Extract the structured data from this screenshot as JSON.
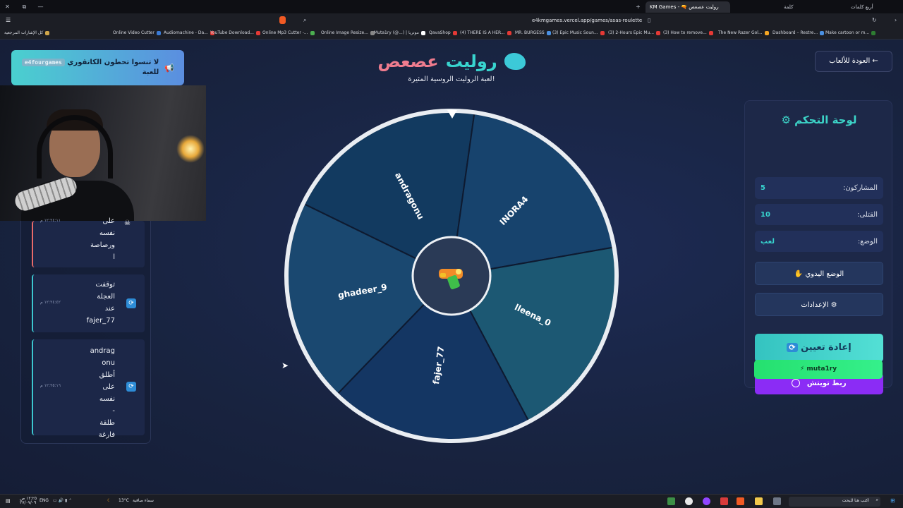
{
  "browser": {
    "tabs": [
      {
        "label": "كلمة",
        "active": false
      },
      {
        "label": "أربع كلمات",
        "active": false
      },
      {
        "label": "KM Games - 🔫 روليت عصعص",
        "active": true
      }
    ],
    "url": "e4kmgames.vercel.app/games/asas-roulette",
    "bookmarks": [
      {
        "label": "كل الإشارات المرجعية",
        "color": "#d0a64a"
      },
      {
        "label": "Online Video Cutter",
        "color": "#3a7bd5"
      },
      {
        "label": "Audiomachine - Da...",
        "color": "#e53935"
      },
      {
        "label": "YouTube Download...",
        "color": "#e53935"
      },
      {
        "label": "Online Mp3 Cutter -...",
        "color": "#4caf50"
      },
      {
        "label": "Online Image Resize...",
        "color": "#888888"
      },
      {
        "label": "Muta1ry (@...) | موتريا",
        "color": "#ffffff"
      },
      {
        "label": "QavaShop",
        "color": "#e53935"
      },
      {
        "label": "(4) THERE IS A HER...",
        "color": "#e53935"
      },
      {
        "label": "MR. BURGESS",
        "color": "#4a90e2"
      },
      {
        "label": "(3) Epic Music Soun...",
        "color": "#e53935"
      },
      {
        "label": "(3) 2-Hours Epic Mu...",
        "color": "#e53935"
      },
      {
        "label": "(3) How to remove...",
        "color": "#e53935"
      },
      {
        "label": "The New Razer Gol...",
        "color": "#f5a623"
      },
      {
        "label": "Dashboard – Restre...",
        "color": "#4a90e2"
      },
      {
        "label": "Make cartoon or m...",
        "color": "#2e7d32"
      }
    ]
  },
  "notice": {
    "text": "لا تنسوا تحطون الكاتقوري",
    "tag": "e4fourgames",
    "text2": "للعبة"
  },
  "header": {
    "title_main": "روليت",
    "title_accent": "عصعص",
    "subtitle": "لعبة الروليت الروسية المثيرة!",
    "back_label": "← العودة للألعاب"
  },
  "wheel": {
    "segments": [
      {
        "name": "andragonu",
        "color": "#123a60"
      },
      {
        "name": "INORA4",
        "color": "#17436d"
      },
      {
        "name": "lleena_0",
        "color": "#1c5873"
      },
      {
        "name": "fajer_77",
        "color": "#143663"
      },
      {
        "name": "ghadeer_9",
        "color": "#1a4870"
      }
    ],
    "center_icon": "water-gun-icon"
  },
  "log": {
    "items": [
      {
        "lines": [
          "على",
          "نفسه",
          "ورصاصة",
          "ا"
        ],
        "time": "١٢:٢٤:١١ م",
        "style": "red"
      },
      {
        "lines": [
          "توقفت",
          "العجلة",
          "عند",
          "fajer_77"
        ],
        "time": "١٢:٢٤:٤٢ م",
        "style": "cyan"
      },
      {
        "lines": [
          "andrag",
          "onu",
          "أطلق",
          "على",
          "نفسه",
          "-",
          "طلقة",
          "فارغة"
        ],
        "time": "١٢:٢٥:١٦ م",
        "style": "cyan"
      }
    ]
  },
  "panel": {
    "title": "لوحة التحكم",
    "stats": [
      {
        "label": "المشاركون:",
        "value": "5"
      },
      {
        "label": "القتلى:",
        "value": "10"
      },
      {
        "label": "الوضع:",
        "value": "لعب"
      }
    ],
    "manual_label": "الوضع اليدوي ✋",
    "settings_label": "⚙ الإعدادات",
    "reset_label": "إعادة تعيين",
    "twitch_label": "ربط تويتش",
    "channel_label": "muta1ry ⚡"
  },
  "taskbar": {
    "search_placeholder": "اكتب هنا للبحث",
    "weather_temp": "13°C",
    "weather_text": "سماء صافية",
    "lang": "ENG",
    "time": "١٢:٢٥ ص",
    "date": "٢٧/٠٧/٠٩"
  },
  "colors": {
    "accent": "#38d4cf",
    "title_accent": "#ef7c8e",
    "twitch": "#8b2cf5",
    "green": "#25e06f"
  }
}
